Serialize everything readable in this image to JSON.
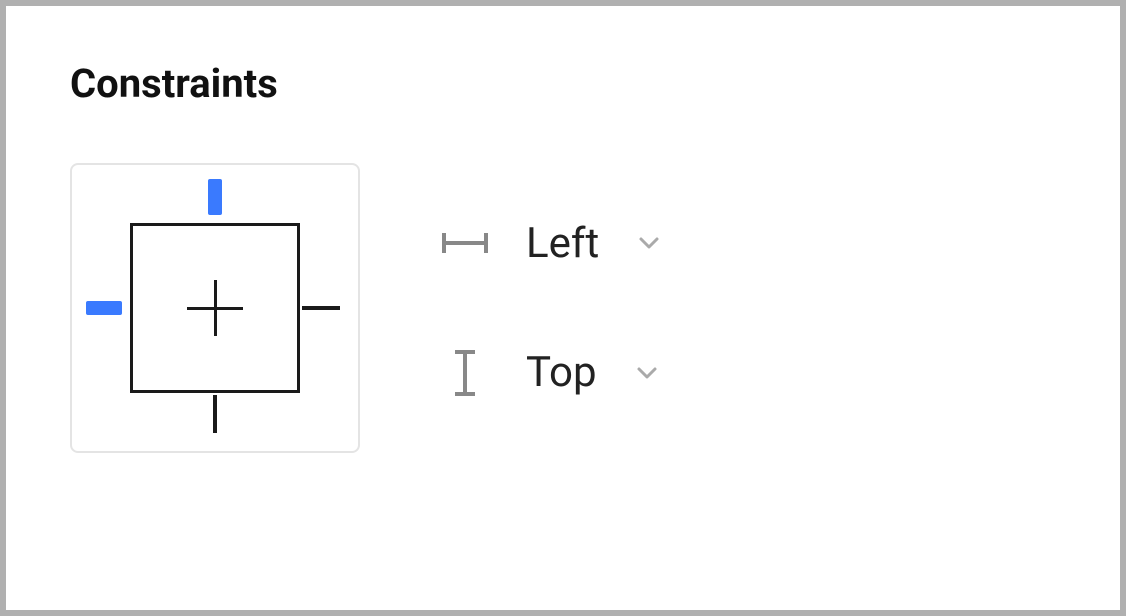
{
  "section": {
    "title": "Constraints"
  },
  "constraints": {
    "horizontal": {
      "label": "Left"
    },
    "vertical": {
      "label": "Top"
    },
    "accent_color": "#3A7AFE",
    "pins": {
      "top_active": true,
      "left_active": true,
      "right_active": false,
      "bottom_active": false
    }
  }
}
